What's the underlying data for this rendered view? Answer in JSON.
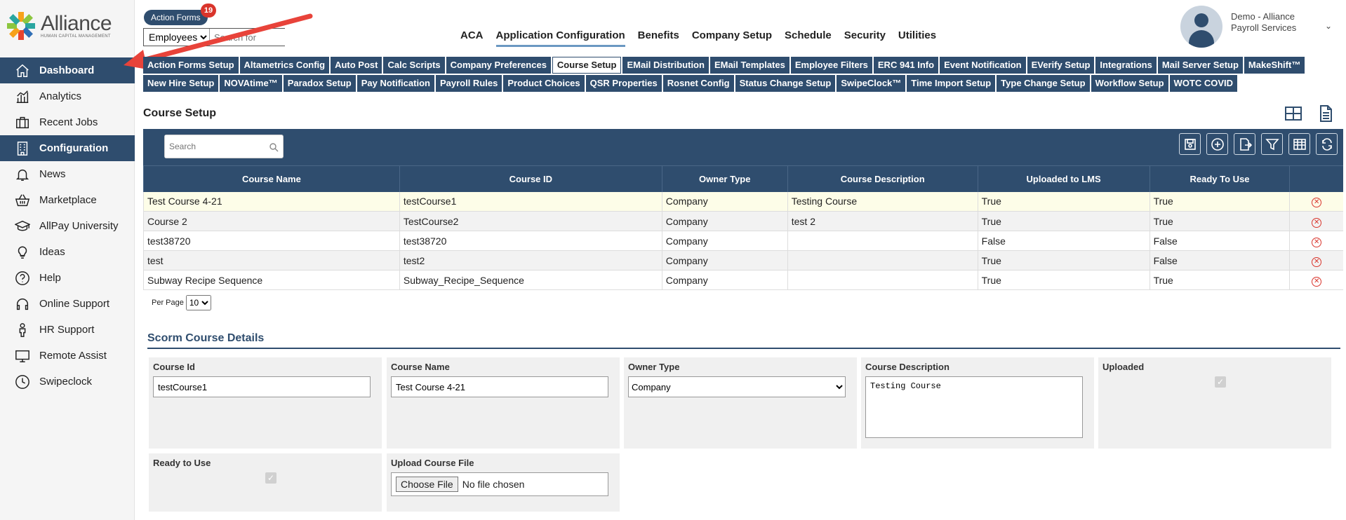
{
  "brand": {
    "name": "Alliance",
    "tagline": "HUMAN CAPITAL MANAGEMENT"
  },
  "sidebar": {
    "items": [
      {
        "label": "Dashboard",
        "icon": "home-icon",
        "active": true
      },
      {
        "label": "Analytics",
        "icon": "analytics-icon"
      },
      {
        "label": "Recent Jobs",
        "icon": "briefcase-icon"
      },
      {
        "label": "Configuration",
        "icon": "building-icon",
        "active": true
      },
      {
        "label": "News",
        "icon": "bell-icon"
      },
      {
        "label": "Marketplace",
        "icon": "basket-icon"
      },
      {
        "label": "AllPay University",
        "icon": "graduation-cap-icon"
      },
      {
        "label": "Ideas",
        "icon": "lightbulb-icon"
      },
      {
        "label": "Help",
        "icon": "question-icon"
      },
      {
        "label": "Online Support",
        "icon": "headset-icon"
      },
      {
        "label": "HR Support",
        "icon": "person-icon"
      },
      {
        "label": "Remote Assist",
        "icon": "monitor-icon"
      },
      {
        "label": "Swipeclock",
        "icon": "clock-icon"
      }
    ]
  },
  "header": {
    "action_forms_label": "Action Forms",
    "action_forms_count": "19",
    "employee_select": "Employees",
    "search_placeholder": "Search for",
    "nav": [
      "ACA",
      "Application Configuration",
      "Benefits",
      "Company Setup",
      "Schedule",
      "Security",
      "Utilities"
    ],
    "user_name": "Demo - Alliance Payroll Services"
  },
  "subtabs": {
    "row1": [
      "Action Forms Setup",
      "Altametrics Config",
      "Auto Post",
      "Calc Scripts",
      "Company Preferences",
      "Course Setup",
      "EMail Distribution",
      "EMail Templates",
      "Employee Filters",
      "ERC 941 Info",
      "Event Notification",
      "EVerify Setup",
      "Integrations",
      "Mail Server Setup",
      "MakeShift™"
    ],
    "row2": [
      "New Hire Setup",
      "NOVAtime™",
      "Paradox Setup",
      "Pay Notification",
      "Payroll Rules",
      "Product Choices",
      "QSR Properties",
      "Rosnet Config",
      "Status Change Setup",
      "SwipeClock™",
      "Time Import Setup",
      "Type Change Setup",
      "Workflow Setup",
      "WOTC COVID"
    ],
    "active": "Course Setup"
  },
  "page": {
    "title": "Course Setup"
  },
  "grid": {
    "search_placeholder": "Search",
    "columns": [
      "Course Name",
      "Course ID",
      "Owner Type",
      "Course Description",
      "Uploaded to LMS",
      "Ready To Use"
    ],
    "rows": [
      [
        "Test Course 4-21",
        "testCourse1",
        "Company",
        "Testing Course",
        "True",
        "True"
      ],
      [
        "Course 2",
        "TestCourse2",
        "Company",
        "test 2",
        "True",
        "True"
      ],
      [
        "test38720",
        "test38720",
        "Company",
        "",
        "False",
        "False"
      ],
      [
        "test",
        "test2",
        "Company",
        "",
        "True",
        "False"
      ],
      [
        "Subway Recipe Sequence",
        "Subway_Recipe_Sequence",
        "Company",
        "",
        "True",
        "True"
      ]
    ],
    "per_page_label": "Per Page",
    "per_page_value": "10"
  },
  "details": {
    "title": "Scorm Course Details",
    "course_id_label": "Course Id",
    "course_id_value": "testCourse1",
    "course_name_label": "Course Name",
    "course_name_value": "Test Course 4-21",
    "owner_type_label": "Owner Type",
    "owner_type_value": "Company",
    "description_label": "Course Description",
    "description_value": "Testing Course",
    "uploaded_label": "Uploaded",
    "ready_label": "Ready to Use",
    "upload_label": "Upload Course File",
    "choose_file": "Choose File",
    "no_file": "No file chosen"
  },
  "colors": {
    "primary": "#2f4d6e",
    "accent_underline": "#6b98c2",
    "badge": "#d9342b",
    "selected_row": "#fdfde8"
  }
}
